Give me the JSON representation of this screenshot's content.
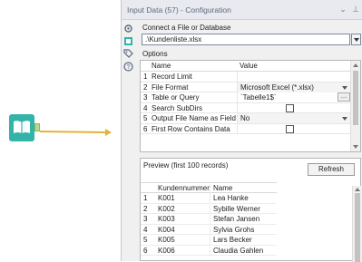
{
  "panel": {
    "title": "Input Data (57) - Configuration"
  },
  "connect": {
    "label": "Connect a File or Database",
    "value": ".\\Kundenliste.xlsx"
  },
  "options": {
    "label": "Options",
    "headers": {
      "name": "Name",
      "value": "Value"
    },
    "rows": [
      {
        "num": "1",
        "name": "Record Limit",
        "value": ""
      },
      {
        "num": "2",
        "name": "File Format",
        "value": "Microsoft Excel (*.xlsx)"
      },
      {
        "num": "3",
        "name": "Table or Query",
        "value": "`Tabelle1$`"
      },
      {
        "num": "4",
        "name": "Search SubDirs",
        "value": ""
      },
      {
        "num": "5",
        "name": "Output File Name as Field",
        "value": "No"
      },
      {
        "num": "6",
        "name": "First Row Contains Data",
        "value": ""
      }
    ]
  },
  "preview": {
    "label": "Preview (first 100 records)",
    "refresh_label": "Refresh",
    "headers": {
      "k": "Kundennummer",
      "n": "Name"
    },
    "rows": [
      {
        "num": "1",
        "k": "K001",
        "n": "Lea Hanke"
      },
      {
        "num": "2",
        "k": "K002",
        "n": "Sybille Werner"
      },
      {
        "num": "3",
        "k": "K003",
        "n": "Stefan Jansen"
      },
      {
        "num": "4",
        "k": "K004",
        "n": "Sylvia Grohs"
      },
      {
        "num": "5",
        "k": "K005",
        "n": "Lars Becker"
      },
      {
        "num": "6",
        "k": "K006",
        "n": "Claudia Gahlen"
      }
    ]
  },
  "icons": {
    "tool": "input-data-book-icon",
    "side": [
      "gear-icon",
      "input-data-icon",
      "tag-icon",
      "help-icon"
    ]
  },
  "colors": {
    "tool_teal": "#34b3a9",
    "connector_gold": "#e3b33b"
  }
}
